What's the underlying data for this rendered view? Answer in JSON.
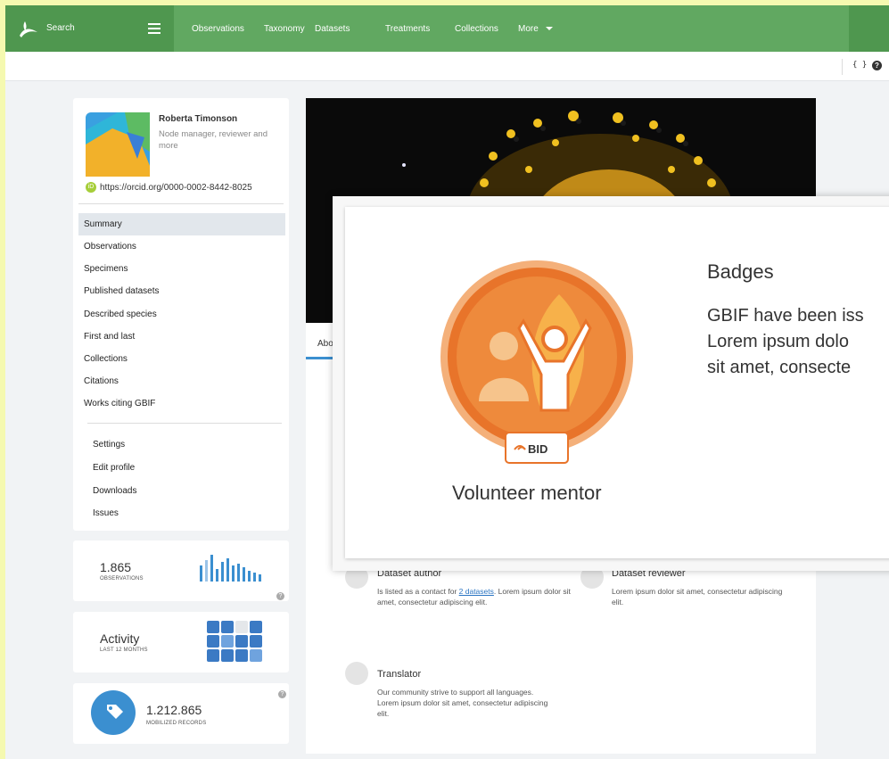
{
  "nav": {
    "search_label": "Search",
    "items": [
      "Observations",
      "Taxonomy",
      "Datasets",
      "Treatments",
      "Collections",
      "More"
    ]
  },
  "subbar": {
    "code_icon": "{ }",
    "help_icon": "?"
  },
  "profile": {
    "name": "Roberta Timonson",
    "role": "Node manager, reviewer and more",
    "orcid_badge": "iD",
    "orcid": "https://orcid.org/0000-0002-8442-8025",
    "menu": [
      "Summary",
      "Observations",
      "Specimens",
      "Published datasets",
      "Described species",
      "First and last",
      "Collections",
      "Citations",
      "Works citing GBIF"
    ],
    "menu_secondary": [
      "Settings",
      "Edit profile",
      "Downloads",
      "Issues"
    ]
  },
  "stats": {
    "observations": {
      "value": "1.865",
      "label": "OBSERVATIONS"
    },
    "activity": {
      "title": "Activity",
      "label": "LAST 12 MONTHS"
    },
    "mobilized": {
      "value": "1.212.865",
      "label": "MOBILIZED RECORDS"
    },
    "help": "?"
  },
  "main": {
    "tab_about": "Abo",
    "features": [
      {
        "title": "Dataset author",
        "text_before": "Is listed as a contact for ",
        "link": "2 datasets",
        "text_after": ". Lorem ipsum dolor sit amet, consectetur adipiscing elit."
      },
      {
        "title": "Dataset reviewer",
        "text": "Lorem ipsum dolor sit amet, consectetur adipiscing elit."
      },
      {
        "title": "Translator",
        "text": "Our community strive to support all languages. Lorem ipsum dolor sit amet, consectetur adipiscing elit."
      }
    ]
  },
  "overlay": {
    "badge_name": "Volunteer mentor",
    "badge_tag": "BID",
    "heading": "Badges",
    "lines": [
      "GBIF have been iss",
      "Lorem ipsum dolo",
      "sit amet, consecte"
    ]
  },
  "colors": {
    "nav_green": "#61a861",
    "nav_dark": "#4f974f",
    "badge_orange": "#e8742a",
    "link_blue": "#2a74c2"
  },
  "icons": [
    "gbif-logo-icon",
    "hamburger-icon",
    "chevron-down-icon",
    "code-icon",
    "help-icon",
    "orcid-icon",
    "tag-icon",
    "feature-icon"
  ]
}
